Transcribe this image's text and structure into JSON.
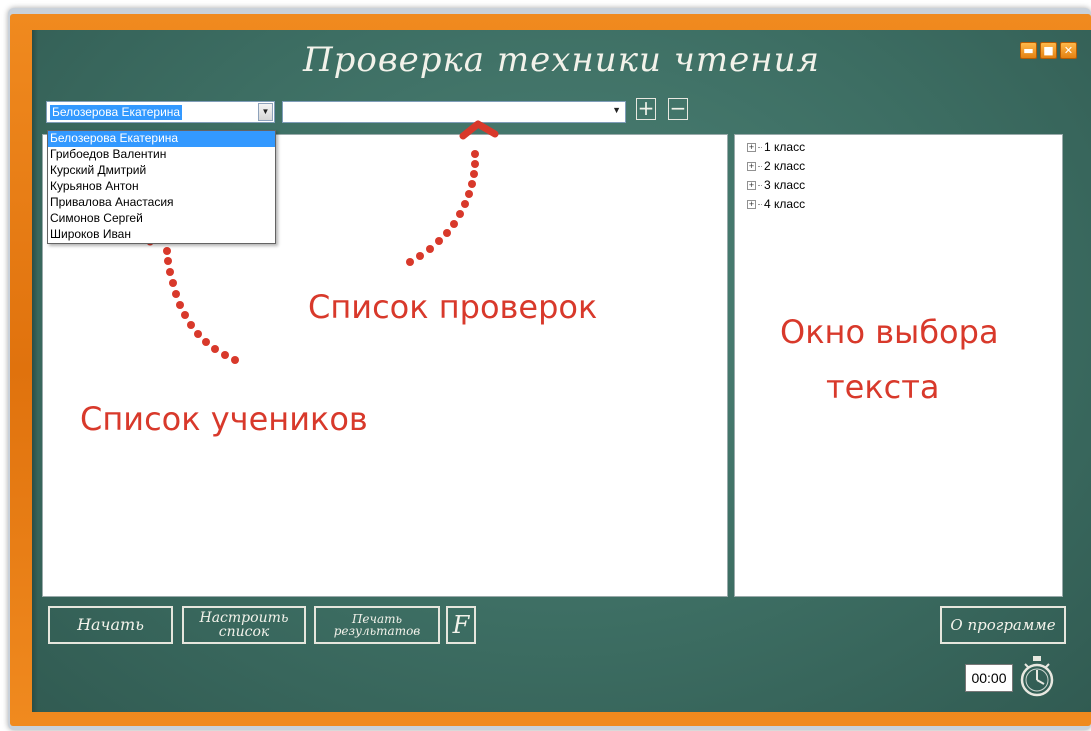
{
  "app": {
    "title": "Проверка техники чтения"
  },
  "window_controls": {
    "minimize": "▬",
    "maximize": "■",
    "close": "✕"
  },
  "student_combo": {
    "value": "Белозерова Екатерина"
  },
  "check_combo": {
    "value": ""
  },
  "buttons": {
    "add": "+",
    "remove": "−"
  },
  "students": [
    "Белозерова Екатерина",
    "Грибоедов Валентин",
    "Курский Дмитрий",
    "Курьянов Антон",
    "Привалова Анастасия",
    "Симонов Сергей",
    "Широков Иван"
  ],
  "tree": [
    "1 класс",
    "2 класс",
    "3 класс",
    "4 класс"
  ],
  "annotations": {
    "checks": "Список проверок",
    "students": "Список учеников",
    "text_window_1": "Окно выбора",
    "text_window_2": "текста"
  },
  "bottom": {
    "start": "Начать",
    "configure_1": "Настроить",
    "configure_2": "список",
    "print_1": "Печать",
    "print_2": "результатов",
    "font": "F",
    "about": "О программе",
    "timer": "00:00"
  },
  "colors": {
    "board": "#3d6e63",
    "frame": "#e87c14",
    "annotation": "#d8392b",
    "selection": "#3399ff"
  }
}
